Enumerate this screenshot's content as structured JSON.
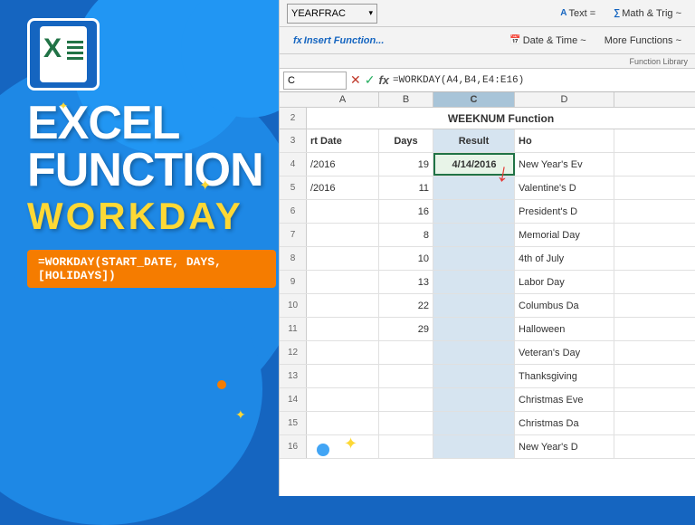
{
  "background": {
    "color": "#1565C0"
  },
  "left": {
    "title_line1": "EXCEL",
    "title_line2": "FUNCTION",
    "workday": "WORKDAY",
    "formula_syntax": "=WORKDAY(START_DATE, DAYS, [HOLIDAYS])"
  },
  "ribbon": {
    "name_box_value": "YEARFRAC",
    "text_btn": "Text =",
    "math_trig_btn": "Math & Trig ~",
    "more_functions_btn": "More Functions ~",
    "date_time_btn": "Date & Time ~",
    "function_library_label": "Function Library",
    "insert_function_label": "Insert Function...",
    "cell_ref": "C",
    "formula_text": "=WORKDAY(A4,B4,E4:E16)"
  },
  "spreadsheet": {
    "merged_header": "WEEKNUM Function",
    "col_headers": [
      "A",
      "B",
      "C",
      "D"
    ],
    "col_labels": [
      "Start Date",
      "Days",
      "Result",
      "Ho"
    ],
    "rows": [
      {
        "num": "3",
        "a": "rt Date",
        "b": "Days",
        "c": "Result",
        "d": "Ho",
        "header": true
      },
      {
        "num": "4",
        "a": "/2016",
        "b": "19",
        "c": "4/14/2016",
        "d": "New Year's Ev",
        "active": true
      },
      {
        "num": "5",
        "a": "/2016",
        "b": "11",
        "c": "",
        "d": "Valentine's D"
      },
      {
        "num": "6",
        "a": "",
        "b": "16",
        "c": "",
        "d": "President's D"
      },
      {
        "num": "7",
        "a": "",
        "b": "8",
        "c": "",
        "d": "Memorial Day"
      },
      {
        "num": "8",
        "a": "",
        "b": "10",
        "c": "",
        "d": "4th of July"
      },
      {
        "num": "9",
        "a": "",
        "b": "13",
        "c": "",
        "d": "Labor Day"
      },
      {
        "num": "10",
        "a": "",
        "b": "22",
        "c": "",
        "d": "Columbus Da"
      },
      {
        "num": "11",
        "a": "",
        "b": "29",
        "c": "",
        "d": "Halloween"
      },
      {
        "num": "12",
        "a": "",
        "b": "",
        "c": "",
        "d": "Veteran's Day"
      },
      {
        "num": "13",
        "a": "",
        "b": "",
        "c": "",
        "d": "Thanksgiving"
      },
      {
        "num": "14",
        "a": "",
        "b": "",
        "c": "",
        "d": "Christmas Eve"
      },
      {
        "num": "15",
        "a": "",
        "b": "",
        "c": "",
        "d": "Christmas Da"
      },
      {
        "num": "16",
        "a": "",
        "b": "",
        "c": "",
        "d": "New Year's D"
      }
    ]
  },
  "stars": [
    {
      "id": "star1",
      "symbol": "✦"
    },
    {
      "id": "star2",
      "symbol": "✦"
    },
    {
      "id": "star3",
      "symbol": "✦"
    },
    {
      "id": "star4",
      "symbol": "✦"
    }
  ],
  "icons": {
    "cancel": "✕",
    "confirm": "✓",
    "fx": "fx",
    "dropdown": "▾",
    "insert_fn_icon": "fx"
  }
}
